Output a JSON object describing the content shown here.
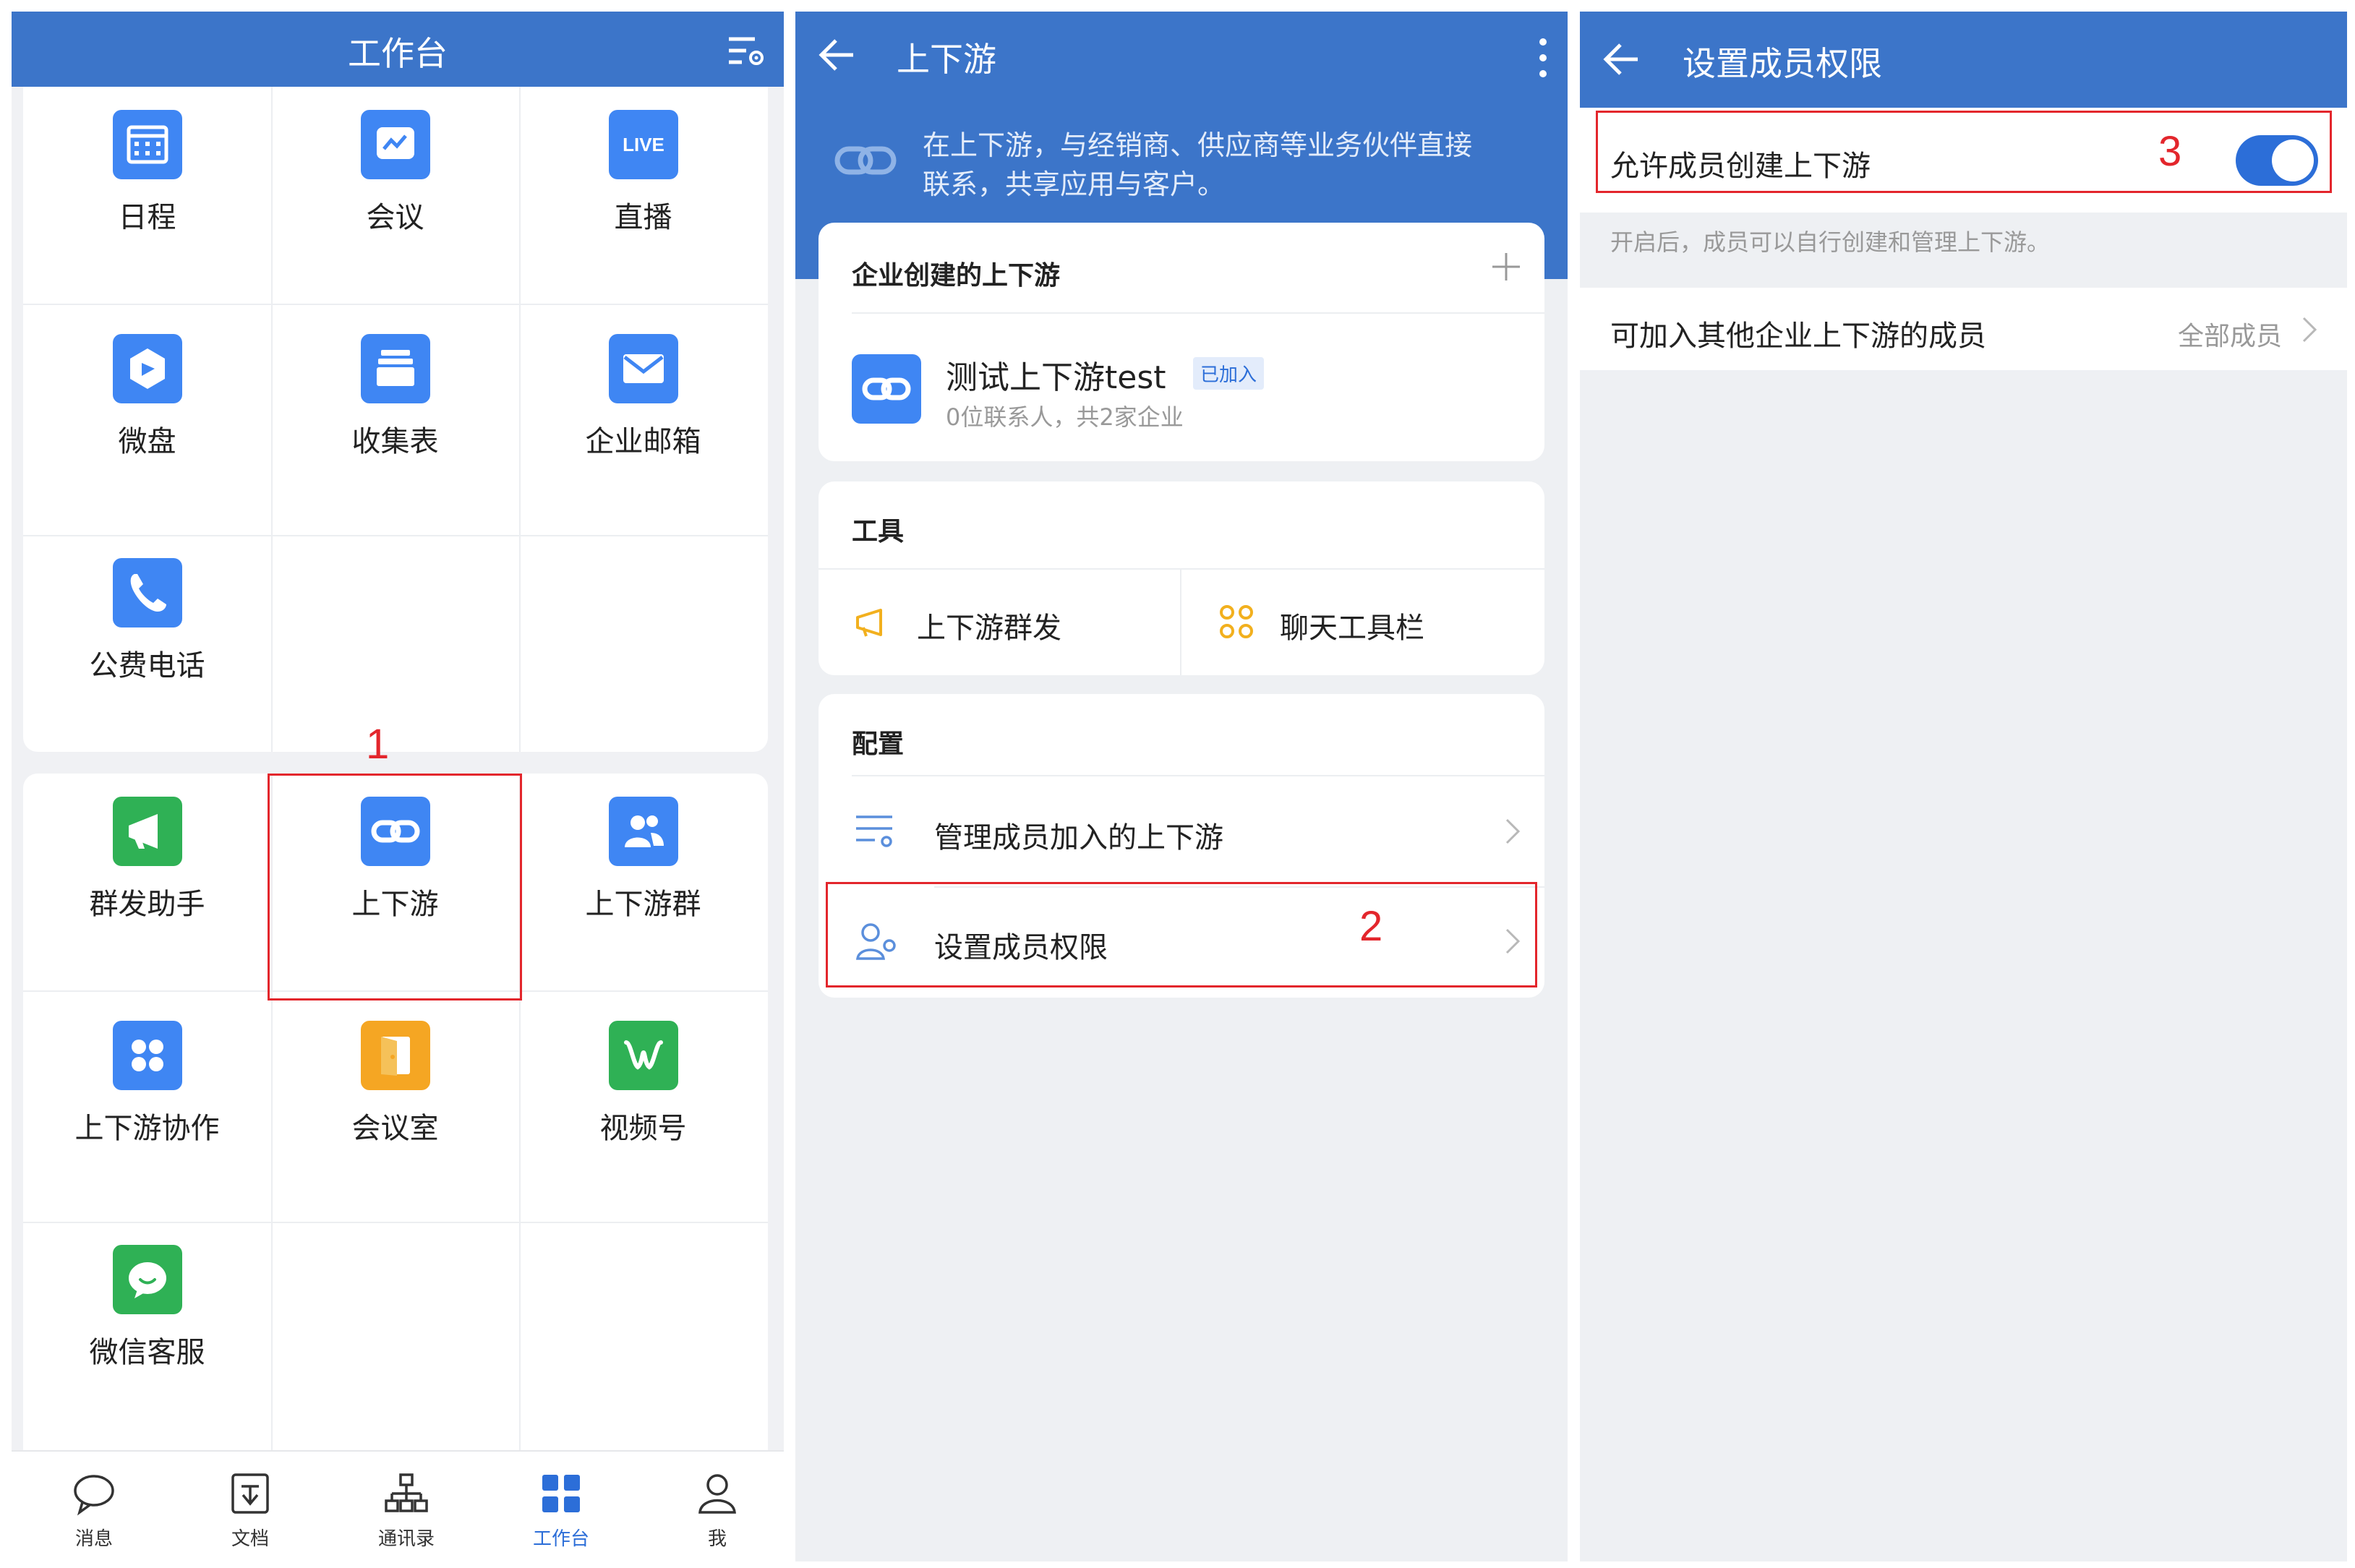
{
  "panel1": {
    "title": "工作台",
    "apps_group1": [
      {
        "label": "日程",
        "icon": "calendar-icon",
        "color": "#3f86f3"
      },
      {
        "label": "会议",
        "icon": "meeting-icon",
        "color": "#3f86f3"
      },
      {
        "label": "直播",
        "icon": "live-icon",
        "color": "#3f86f3",
        "badge": "LIVE"
      },
      {
        "label": "微盘",
        "icon": "drive-icon",
        "color": "#3f86f3"
      },
      {
        "label": "收集表",
        "icon": "form-icon",
        "color": "#3f86f3"
      },
      {
        "label": "企业邮箱",
        "icon": "mail-icon",
        "color": "#3f86f3"
      },
      {
        "label": "公费电话",
        "icon": "phone-icon",
        "color": "#3f86f3"
      }
    ],
    "apps_group2": [
      {
        "label": "群发助手",
        "icon": "broadcast-icon",
        "color": "#2fb155"
      },
      {
        "label": "上下游",
        "icon": "link-icon",
        "color": "#3f86f3"
      },
      {
        "label": "上下游群",
        "icon": "group-icon",
        "color": "#3f86f3"
      },
      {
        "label": "上下游协作",
        "icon": "apps-icon",
        "color": "#3f86f3"
      },
      {
        "label": "会议室",
        "icon": "door-icon",
        "color": "#f5a623"
      },
      {
        "label": "视频号",
        "icon": "channels-icon",
        "color": "#2fb155"
      },
      {
        "label": "微信客服",
        "icon": "chat-bubble-icon",
        "color": "#2fb155"
      }
    ],
    "nav": [
      {
        "label": "消息",
        "icon": "message-icon"
      },
      {
        "label": "文档",
        "icon": "doc-icon"
      },
      {
        "label": "通讯录",
        "icon": "contacts-icon"
      },
      {
        "label": "工作台",
        "icon": "workbench-icon",
        "active": true
      },
      {
        "label": "我",
        "icon": "me-icon"
      }
    ],
    "step_label": "1"
  },
  "panel2": {
    "title": "上下游",
    "intro": [
      "在上下游，与经销商、供应商等业务伙伴直接",
      "联系，共享应用与客户。"
    ],
    "created_section": "企业创建的上下游",
    "item_name": "测试上下游test",
    "item_badge": "已加入",
    "item_sub": "0位联系人，共2家企业",
    "tools_section": "工具",
    "tool1": "上下游群发",
    "tool2": "聊天工具栏",
    "config_section": "配置",
    "config1": "管理成员加入的上下游",
    "config2": "设置成员权限",
    "step_label": "2"
  },
  "panel3": {
    "title": "设置成员权限",
    "toggle_label": "允许成员创建上下游",
    "toggle_on": true,
    "note": "开启后，成员可以自行创建和管理上下游。",
    "row_label": "可加入其他企业上下游的成员",
    "row_value": "全部成员",
    "step_label": "3"
  },
  "colors": {
    "brand_blue": "#3c75c9",
    "accent_blue": "#2c6ed8",
    "annotation_red": "#e3262c"
  }
}
